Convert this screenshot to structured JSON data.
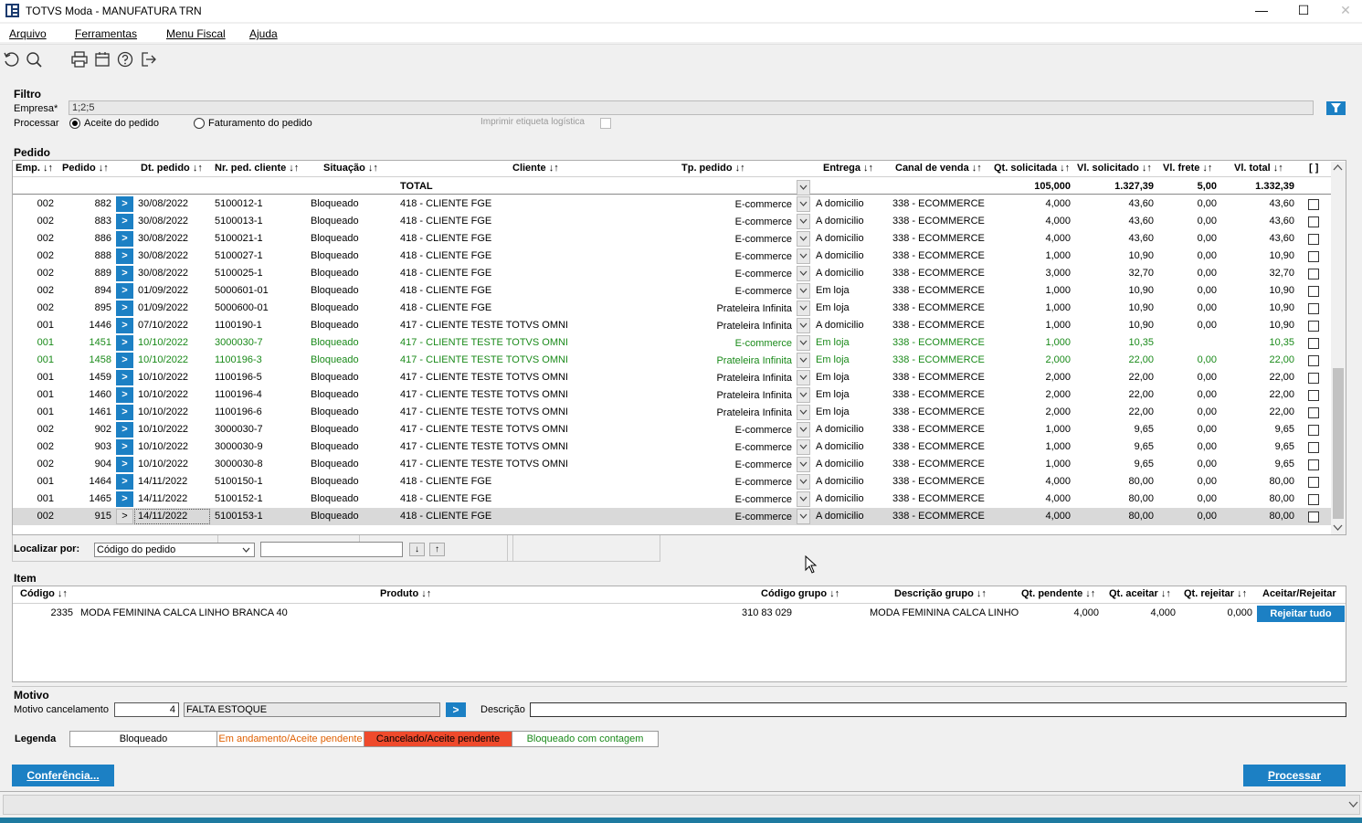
{
  "window": {
    "title": "TOTVS Moda - MANUFATURA TRN",
    "controls": [
      "—",
      "☐",
      "✕"
    ]
  },
  "menu": [
    "Arquivo",
    "Ferramentas",
    "Menu Fiscal",
    "Ajuda"
  ],
  "toolbar_icons": [
    "refresh-icon",
    "search-icon",
    "print-icon",
    "calendar-icon",
    "help-icon",
    "exit-icon"
  ],
  "filtro": {
    "section_label": "Filtro",
    "empresa_label": "Empresa*",
    "empresa_value": "1;2;5",
    "processar_label": "Processar",
    "radio_aceite": "Aceite do pedido",
    "radio_faturamento": "Faturamento do pedido",
    "imprimir_label": "Imprimir etiqueta logística"
  },
  "pedido": {
    "section_label": "Pedido",
    "headers": {
      "emp": "Emp. ↓↑",
      "pedido": "Pedido ↓↑",
      "dt": "Dt. pedido ↓↑",
      "nr": "Nr. ped. cliente ↓↑",
      "situacao": "Situação ↓↑",
      "cliente": "Cliente ↓↑",
      "tp": "Tp. pedido ↓↑",
      "entrega": "Entrega ↓↑",
      "canal": "Canal de venda ↓↑",
      "qt": "Qt. solicitada ↓↑",
      "vl": "Vl. solicitado ↓↑",
      "frete": "Vl. frete ↓↑",
      "total": "Vl. total ↓↑",
      "sel": "[ ]"
    },
    "total_row": {
      "label": "TOTAL",
      "qt": "105,000",
      "vl": "1.327,39",
      "frete": "5,00",
      "total": "1.332,39"
    },
    "rows": [
      {
        "emp": "002",
        "pedido": "882",
        "dt": "30/08/2022",
        "nr": "5100012-1",
        "sit": "Bloqueado",
        "cli": "418 - CLIENTE FGE",
        "tp": "E-commerce",
        "ent": "A domicilio",
        "canal": "338 - ECOMMERCE",
        "qt": "4,000",
        "vl": "43,60",
        "frete": "0,00",
        "total": "43,60",
        "green": false
      },
      {
        "emp": "002",
        "pedido": "883",
        "dt": "30/08/2022",
        "nr": "5100013-1",
        "sit": "Bloqueado",
        "cli": "418 - CLIENTE FGE",
        "tp": "E-commerce",
        "ent": "A domicilio",
        "canal": "338 - ECOMMERCE",
        "qt": "4,000",
        "vl": "43,60",
        "frete": "0,00",
        "total": "43,60",
        "green": false
      },
      {
        "emp": "002",
        "pedido": "886",
        "dt": "30/08/2022",
        "nr": "5100021-1",
        "sit": "Bloqueado",
        "cli": "418 - CLIENTE FGE",
        "tp": "E-commerce",
        "ent": "A domicilio",
        "canal": "338 - ECOMMERCE",
        "qt": "4,000",
        "vl": "43,60",
        "frete": "0,00",
        "total": "43,60",
        "green": false
      },
      {
        "emp": "002",
        "pedido": "888",
        "dt": "30/08/2022",
        "nr": "5100027-1",
        "sit": "Bloqueado",
        "cli": "418 - CLIENTE FGE",
        "tp": "E-commerce",
        "ent": "A domicilio",
        "canal": "338 - ECOMMERCE",
        "qt": "1,000",
        "vl": "10,90",
        "frete": "0,00",
        "total": "10,90",
        "green": false
      },
      {
        "emp": "002",
        "pedido": "889",
        "dt": "30/08/2022",
        "nr": "5100025-1",
        "sit": "Bloqueado",
        "cli": "418 - CLIENTE FGE",
        "tp": "E-commerce",
        "ent": "A domicilio",
        "canal": "338 - ECOMMERCE",
        "qt": "3,000",
        "vl": "32,70",
        "frete": "0,00",
        "total": "32,70",
        "green": false
      },
      {
        "emp": "002",
        "pedido": "894",
        "dt": "01/09/2022",
        "nr": "5000601-01",
        "sit": "Bloqueado",
        "cli": "418 - CLIENTE FGE",
        "tp": "E-commerce",
        "ent": "Em loja",
        "canal": "338 - ECOMMERCE",
        "qt": "1,000",
        "vl": "10,90",
        "frete": "0,00",
        "total": "10,90",
        "green": false
      },
      {
        "emp": "002",
        "pedido": "895",
        "dt": "01/09/2022",
        "nr": "5000600-01",
        "sit": "Bloqueado",
        "cli": "418 - CLIENTE FGE",
        "tp": "Prateleira Infinita",
        "ent": "Em loja",
        "canal": "338 - ECOMMERCE",
        "qt": "1,000",
        "vl": "10,90",
        "frete": "0,00",
        "total": "10,90",
        "green": false
      },
      {
        "emp": "001",
        "pedido": "1446",
        "dt": "07/10/2022",
        "nr": "1100190-1",
        "sit": "Bloqueado",
        "cli": "417 - CLIENTE TESTE TOTVS OMNI",
        "tp": "Prateleira Infinita",
        "ent": "A domicilio",
        "canal": "338 - ECOMMERCE",
        "qt": "1,000",
        "vl": "10,90",
        "frete": "0,00",
        "total": "10,90",
        "green": false
      },
      {
        "emp": "001",
        "pedido": "1451",
        "dt": "10/10/2022",
        "nr": "3000030-7",
        "sit": "Bloqueado",
        "cli": "417 - CLIENTE TESTE TOTVS OMNI",
        "tp": "E-commerce",
        "ent": "Em loja",
        "canal": "338 - ECOMMERCE",
        "qt": "1,000",
        "vl": "10,35",
        "frete": "",
        "total": "10,35",
        "green": true
      },
      {
        "emp": "001",
        "pedido": "1458",
        "dt": "10/10/2022",
        "nr": "1100196-3",
        "sit": "Bloqueado",
        "cli": "417 - CLIENTE TESTE TOTVS OMNI",
        "tp": "Prateleira Infinita",
        "ent": "Em loja",
        "canal": "338 - ECOMMERCE",
        "qt": "2,000",
        "vl": "22,00",
        "frete": "0,00",
        "total": "22,00",
        "green": true
      },
      {
        "emp": "001",
        "pedido": "1459",
        "dt": "10/10/2022",
        "nr": "1100196-5",
        "sit": "Bloqueado",
        "cli": "417 - CLIENTE TESTE TOTVS OMNI",
        "tp": "Prateleira Infinita",
        "ent": "Em loja",
        "canal": "338 - ECOMMERCE",
        "qt": "2,000",
        "vl": "22,00",
        "frete": "0,00",
        "total": "22,00",
        "green": false
      },
      {
        "emp": "001",
        "pedido": "1460",
        "dt": "10/10/2022",
        "nr": "1100196-4",
        "sit": "Bloqueado",
        "cli": "417 - CLIENTE TESTE TOTVS OMNI",
        "tp": "Prateleira Infinita",
        "ent": "Em loja",
        "canal": "338 - ECOMMERCE",
        "qt": "2,000",
        "vl": "22,00",
        "frete": "0,00",
        "total": "22,00",
        "green": false
      },
      {
        "emp": "001",
        "pedido": "1461",
        "dt": "10/10/2022",
        "nr": "1100196-6",
        "sit": "Bloqueado",
        "cli": "417 - CLIENTE TESTE TOTVS OMNI",
        "tp": "Prateleira Infinita",
        "ent": "Em loja",
        "canal": "338 - ECOMMERCE",
        "qt": "2,000",
        "vl": "22,00",
        "frete": "0,00",
        "total": "22,00",
        "green": false
      },
      {
        "emp": "002",
        "pedido": "902",
        "dt": "10/10/2022",
        "nr": "3000030-7",
        "sit": "Bloqueado",
        "cli": "417 - CLIENTE TESTE TOTVS OMNI",
        "tp": "E-commerce",
        "ent": "A domicilio",
        "canal": "338 - ECOMMERCE",
        "qt": "1,000",
        "vl": "9,65",
        "frete": "0,00",
        "total": "9,65",
        "green": false
      },
      {
        "emp": "002",
        "pedido": "903",
        "dt": "10/10/2022",
        "nr": "3000030-9",
        "sit": "Bloqueado",
        "cli": "417 - CLIENTE TESTE TOTVS OMNI",
        "tp": "E-commerce",
        "ent": "A domicilio",
        "canal": "338 - ECOMMERCE",
        "qt": "1,000",
        "vl": "9,65",
        "frete": "0,00",
        "total": "9,65",
        "green": false
      },
      {
        "emp": "002",
        "pedido": "904",
        "dt": "10/10/2022",
        "nr": "3000030-8",
        "sit": "Bloqueado",
        "cli": "417 - CLIENTE TESTE TOTVS OMNI",
        "tp": "E-commerce",
        "ent": "A domicilio",
        "canal": "338 - ECOMMERCE",
        "qt": "1,000",
        "vl": "9,65",
        "frete": "0,00",
        "total": "9,65",
        "green": false
      },
      {
        "emp": "001",
        "pedido": "1464",
        "dt": "14/11/2022",
        "nr": "5100150-1",
        "sit": "Bloqueado",
        "cli": "418 - CLIENTE FGE",
        "tp": "E-commerce",
        "ent": "A domicilio",
        "canal": "338 - ECOMMERCE",
        "qt": "4,000",
        "vl": "80,00",
        "frete": "0,00",
        "total": "80,00",
        "green": false
      },
      {
        "emp": "001",
        "pedido": "1465",
        "dt": "14/11/2022",
        "nr": "5100152-1",
        "sit": "Bloqueado",
        "cli": "418 - CLIENTE FGE",
        "tp": "E-commerce",
        "ent": "A domicilio",
        "canal": "338 - ECOMMERCE",
        "qt": "4,000",
        "vl": "80,00",
        "frete": "0,00",
        "total": "80,00",
        "green": false
      },
      {
        "emp": "002",
        "pedido": "915",
        "dt": "14/11/2022",
        "nr": "5100153-1",
        "sit": "Bloqueado",
        "cli": "418 - CLIENTE FGE",
        "tp": "E-commerce",
        "ent": "A domicilio",
        "canal": "338 - ECOMMERCE",
        "qt": "4,000",
        "vl": "80,00",
        "frete": "0,00",
        "total": "80,00",
        "green": false,
        "selected": true
      }
    ],
    "go_label": ">",
    "localizar_label": "Localizar por:",
    "localizar_select": "Código do pedido",
    "localizar_value": "",
    "down_arrow": "↓",
    "up_arrow": "↑"
  },
  "item": {
    "section_label": "Item",
    "headers": {
      "codigo": "Código ↓↑",
      "produto": "Produto ↓↑",
      "grupo": "Código grupo ↓↑",
      "desc": "Descrição grupo ↓↑",
      "pend": "Qt. pendente ↓↑",
      "aceitar": "Qt. aceitar ↓↑",
      "rejeitar": "Qt. rejeitar ↓↑",
      "acao": "Aceitar/Rejeitar"
    },
    "rows": [
      {
        "codigo": "2335",
        "produto": "MODA FEMININA CALCA LINHO BRANCA 40",
        "grupo": "310 83 029",
        "desc": "MODA FEMININA CALCA LINHO",
        "pend": "4,000",
        "aceitar": "4,000",
        "rejeitar": "0,000",
        "acao": "Rejeitar tudo"
      }
    ]
  },
  "motivo": {
    "section_label": "Motivo",
    "cancel_label": "Motivo cancelamento",
    "code": "4",
    "text": "FALTA ESTOQUE",
    "go_label": ">",
    "descricao_label": "Descrição",
    "descricao_value": ""
  },
  "legenda": {
    "label": "Legenda",
    "items": [
      {
        "text": "Bloqueado",
        "color": "#000000",
        "bg": "#ffffff"
      },
      {
        "text": "Em andamento/Aceite pendente",
        "color": "#e06000",
        "bg": "#ffffff"
      },
      {
        "text": "Cancelado/Aceite pendente",
        "color": "#000000",
        "bg": "#ef4a2c"
      },
      {
        "text": "Bloqueado com contagem",
        "color": "#1a8a1a",
        "bg": "#ffffff"
      }
    ]
  },
  "buttons": {
    "conferencia": "Conferência...",
    "processar": "Processar"
  },
  "colors": {
    "accent": "#1c80c4",
    "green_row": "#1a8a1a",
    "selected_row": "#d9d9d9"
  }
}
